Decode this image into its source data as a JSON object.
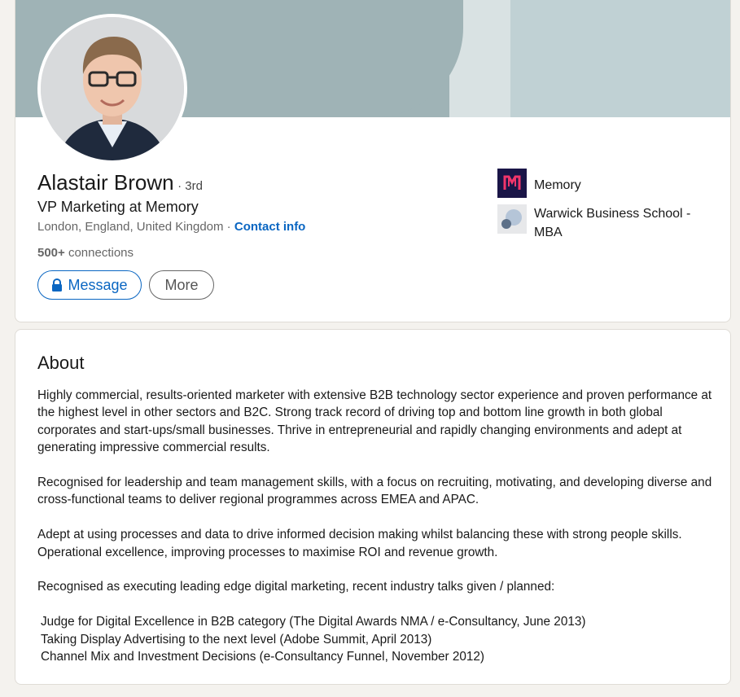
{
  "profile": {
    "name": "Alastair Brown",
    "degree": "· 3rd",
    "headline": "VP Marketing at Memory",
    "location": "London, England, United Kingdom",
    "location_separator": " · ",
    "contact_info_label": "Contact info",
    "connections_count": "500+",
    "connections_label": " connections"
  },
  "actions": {
    "message_label": "Message",
    "more_label": "More"
  },
  "organizations": [
    {
      "name": "Memory",
      "logo": "memory-logo",
      "color": "#1a1547"
    },
    {
      "name": "Warwick Business School - MBA",
      "logo": "warwick-logo",
      "color": "#d4d7db"
    }
  ],
  "about": {
    "title": "About",
    "paragraphs": [
      "Highly commercial, results-oriented marketer with extensive B2B technology sector experience and proven performance at the highest level in other sectors and B2C. Strong track record of driving top and bottom line growth in both global corporates and start-ups/small businesses. Thrive in entrepreneurial and rapidly changing environments and adept at generating impressive commercial results.",
      "Recognised for leadership and team management skills, with a focus on recruiting, motivating, and developing diverse and cross-functional teams to deliver regional programmes across EMEA and APAC.",
      "Adept at using processes and data to drive informed decision making whilst balancing these with strong people skills. Operational excellence, improving processes to maximise ROI and revenue growth.",
      "Recognised as executing leading edge digital marketing, recent industry talks given / planned:"
    ],
    "talks": [
      "Judge for Digital Excellence in B2B category (The Digital Awards NMA / e-Consultancy, June 2013)",
      "Taking Display Advertising to the next level (Adobe Summit, April 2013)",
      "Channel Mix and Investment Decisions (e-Consultancy Funnel, November 2012)"
    ]
  },
  "colors": {
    "accent": "#0a66c2",
    "banner": "#9fb3b6"
  }
}
